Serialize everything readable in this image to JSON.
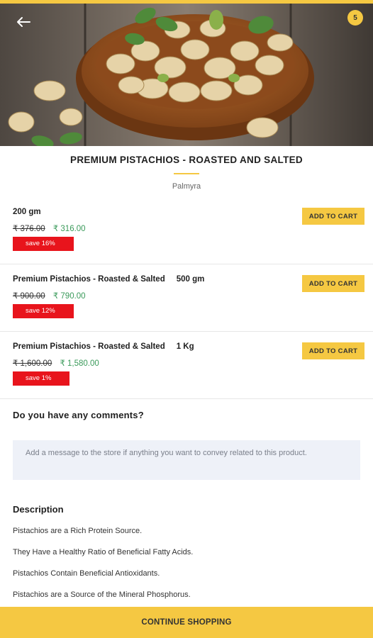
{
  "header": {
    "back_icon": "arrow-left-icon",
    "cart_count": "5"
  },
  "product": {
    "title": "PREMIUM PISTACHIOS - ROASTED AND SALTED",
    "vendor": "Palmyra"
  },
  "variants": [
    {
      "name": "200 gm",
      "old_price": "₹ 376.00",
      "new_price": "₹ 316.00",
      "save": "save 16%",
      "button": "ADD TO CART"
    },
    {
      "name": "Premium Pistachios - Roasted & Salted     500 gm",
      "old_price": "₹ 900.00",
      "new_price": "₹ 790.00",
      "save": "save 12%",
      "button": "ADD TO CART"
    },
    {
      "name": "Premium Pistachios - Roasted & Salted     1 Kg",
      "old_price": "₹ 1,600.00",
      "new_price": "₹ 1,580.00",
      "save": "save 1%",
      "button": "ADD TO CART"
    }
  ],
  "comments": {
    "heading": "Do you have any comments?",
    "placeholder": "Add a message to the store if anything you want to convey related to this product."
  },
  "description": {
    "heading": "Description",
    "lines": [
      "Pistachios are a Rich Protein Source.",
      "They Have a Healthy Ratio of Beneficial Fatty Acids.",
      "Pistachios Contain Beneficial Antioxidants.",
      "Pistachios are a Source of the Mineral Phosphorus."
    ]
  },
  "footer": {
    "continue_label": "CONTINUE SHOPPING"
  },
  "colors": {
    "accent": "#f5c842",
    "save_badge": "#e8141c",
    "new_price": "#3a9a5a"
  }
}
